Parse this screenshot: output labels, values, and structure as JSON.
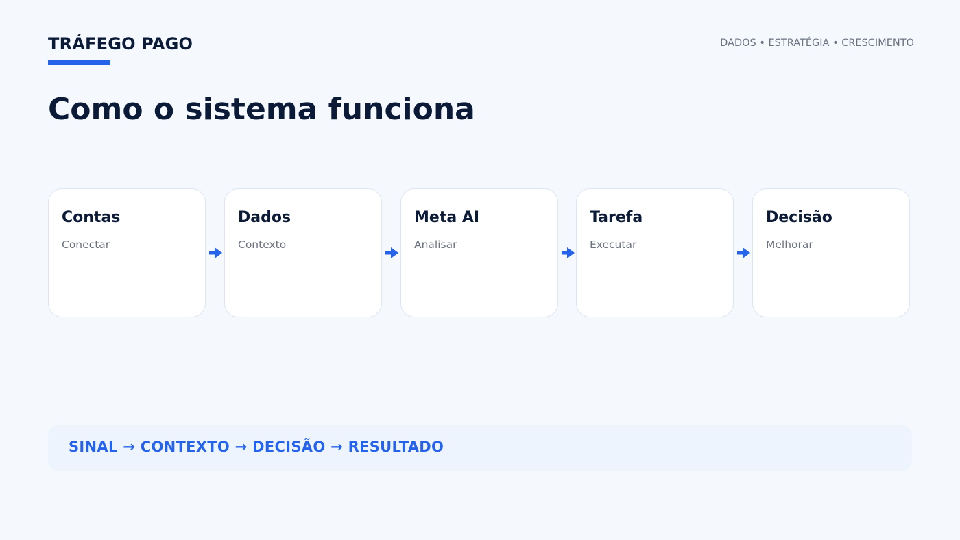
{
  "header": {
    "brand": "TRÁFEGO PAGO",
    "tagline": "DADOS • ESTRATÉGIA • CRESCIMENTO"
  },
  "title": "Como o sistema funciona",
  "steps": [
    {
      "title": "Contas",
      "subtitle": "Conectar"
    },
    {
      "title": "Dados",
      "subtitle": "Contexto"
    },
    {
      "title": "Meta AI",
      "subtitle": "Analisar"
    },
    {
      "title": "Tarefa",
      "subtitle": "Executar"
    },
    {
      "title": "Decisão",
      "subtitle": "Melhorar"
    }
  ],
  "summary": "SINAL → CONTEXTO → DECISÃO → RESULTADO",
  "colors": {
    "accent": "#2563eb",
    "heading": "#0b1a36",
    "muted": "#6b7280",
    "background": "#f5f9fe"
  },
  "icons": {
    "connector": "arrow-right-icon"
  }
}
